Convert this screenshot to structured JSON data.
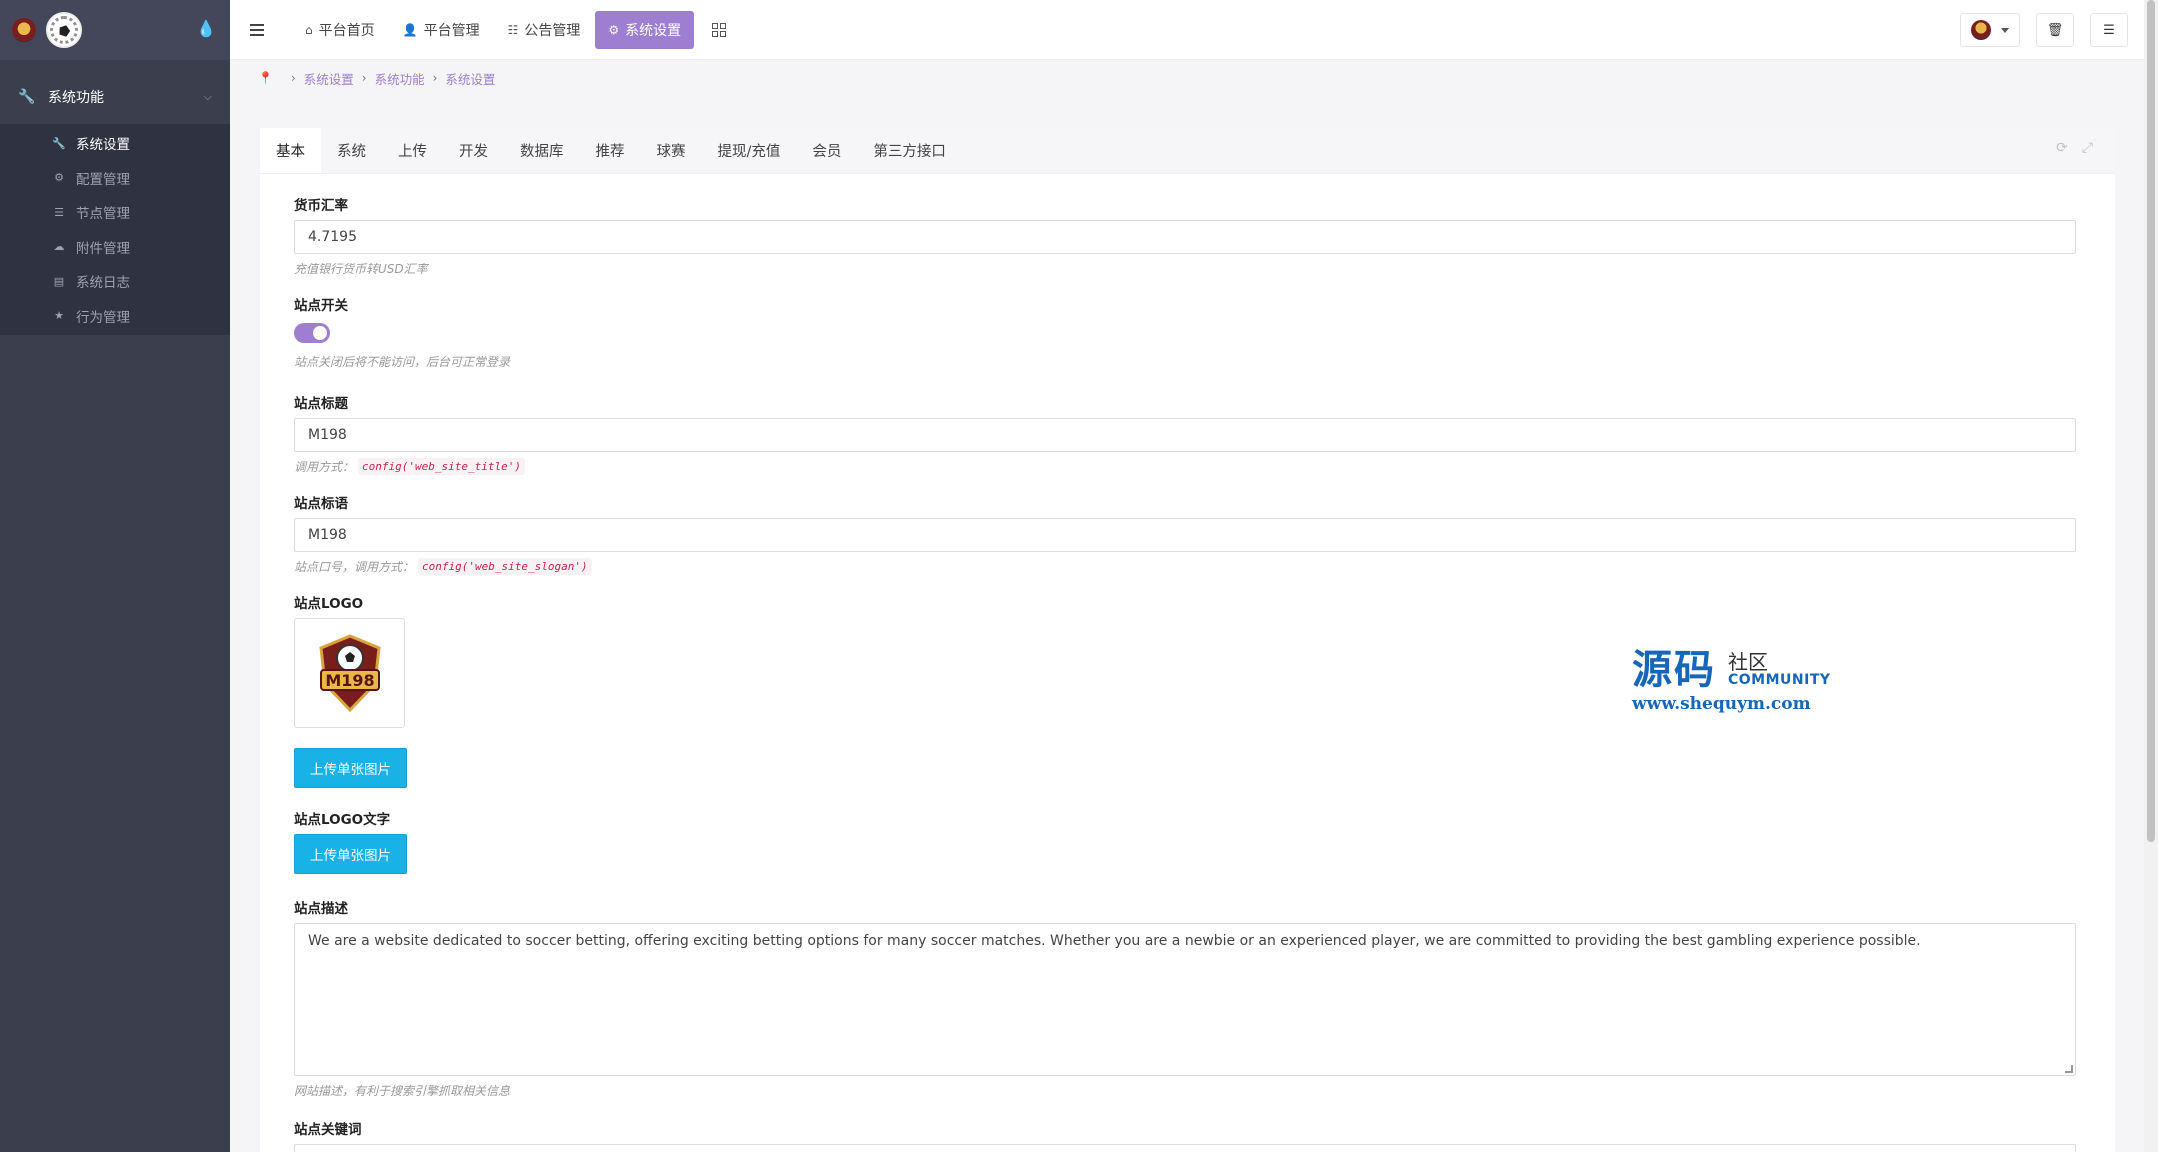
{
  "brand": {
    "logo_icon": "club-badge-logo",
    "ball_icon": "soccer-ball-icon"
  },
  "sidebar": {
    "group_label": "系统功能",
    "items": [
      {
        "label": "系统设置",
        "icon": "wrench-icon",
        "active": true
      },
      {
        "label": "配置管理",
        "icon": "cogs-icon"
      },
      {
        "label": "节点管理",
        "icon": "list-icon"
      },
      {
        "label": "附件管理",
        "icon": "cloud-icon"
      },
      {
        "label": "系统日志",
        "icon": "book-icon"
      },
      {
        "label": "行为管理",
        "icon": "star-icon"
      }
    ]
  },
  "topbar": {
    "nav": [
      {
        "label": "平台首页",
        "icon": "home-icon"
      },
      {
        "label": "平台管理",
        "icon": "user-icon"
      },
      {
        "label": "公告管理",
        "icon": "list-alt-icon"
      },
      {
        "label": "系统设置",
        "icon": "gear-icon",
        "active": true
      }
    ]
  },
  "breadcrumb": [
    "系统设置",
    "系统功能",
    "系统设置"
  ],
  "tabs": [
    "基本",
    "系统",
    "上传",
    "开发",
    "数据库",
    "推荐",
    "球赛",
    "提现/充值",
    "会员",
    "第三方接口"
  ],
  "form": {
    "rate": {
      "label": "货币汇率",
      "value": "4.7195",
      "help": "充值银行货币转USD汇率"
    },
    "site_switch": {
      "label": "站点开关",
      "enabled": true,
      "help": "站点关闭后将不能访问，后台可正常登录"
    },
    "site_title": {
      "label": "站点标题",
      "value": "M198",
      "help": "调用方式：",
      "code": "config('web_site_title')"
    },
    "site_slogan": {
      "label": "站点标语",
      "value": "M198",
      "help": "站点口号，调用方式：",
      "code": "config('web_site_slogan')"
    },
    "site_logo": {
      "label": "站点LOGO",
      "logo_text": "M198",
      "upload_label": "上传单张图片"
    },
    "site_logo_text": {
      "label": "站点LOGO文字",
      "upload_label": "上传单张图片"
    },
    "site_desc": {
      "label": "站点描述",
      "value": "We are a website dedicated to soccer betting, offering exciting betting options for many soccer matches. Whether you are a newbie or an experienced player, we are committed to providing the best gambling experience possible.",
      "help": "网站描述，有利于搜索引擎抓取相关信息"
    },
    "site_keywords": {
      "label": "站点关键词"
    }
  },
  "watermark": {
    "big": "源码",
    "small": "社区",
    "community": "COMMUNITY",
    "url": "www.shequym.com"
  },
  "colors": {
    "accent": "#9e7ed1",
    "upload": "#19b2e6",
    "sidebar": "#3b3e4c"
  }
}
